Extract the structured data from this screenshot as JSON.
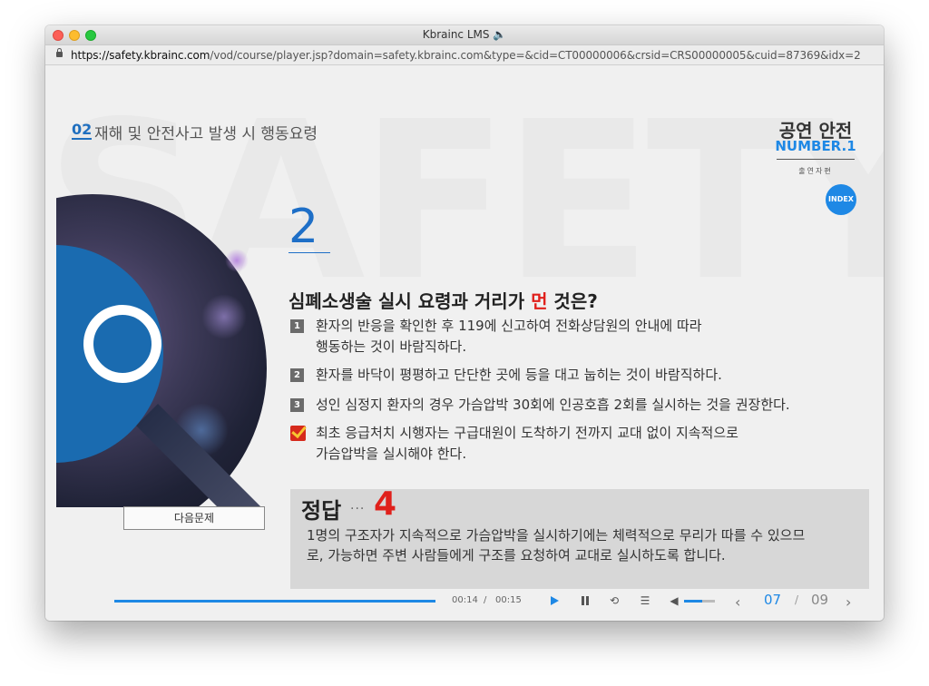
{
  "window": {
    "title": "Kbrainc LMS 🔈"
  },
  "urlbar": {
    "host": "https://safety.kbrainc.com",
    "path": "/vod/course/player.jsp?domain=safety.kbrainc.com&type=&cid=CT00000006&crsid=CRS00000005&cuid=87369&idx=2"
  },
  "header": {
    "section_num": "02",
    "section_title": "재해 및 안전사고 발생 시 행동요령"
  },
  "brand": {
    "title": "공연 안전",
    "number": "NUMBER.1",
    "sub": "출연자편",
    "index_label": "INDEX"
  },
  "question": {
    "number": "2",
    "text_before": "심폐소생술 실시 요령과 거리가 ",
    "text_red": "먼",
    "text_after": " 것은?",
    "options": [
      {
        "num": "1",
        "line1": "환자의 반응을 확인한 후 119에 신고하여 전화상담원의 안내에 따라",
        "line2": "행동하는 것이 바람직하다."
      },
      {
        "num": "2",
        "line1": "환자를 바닥이 평평하고 단단한 곳에 등을 대고 눕히는 것이 바람직하다."
      },
      {
        "num": "3",
        "line1": "성인 심정지 환자의 경우 가슴압박 30회에 인공호흡 2회를 실시하는 것을 권장한다."
      },
      {
        "num": "4",
        "line1": "최초 응급처치 시행자는 구급대원이 도착하기 전까지 교대 없이 지속적으로",
        "line2": "가슴압박을 실시해야 한다.",
        "checked": true
      }
    ]
  },
  "next_button": "다음문제",
  "answer": {
    "label": "정답",
    "dots": "···",
    "value": "4",
    "explanation": "1명의 구조자가 지속적으로 가슴압박을 실시하기에는 체력적으로 무리가 따를 수 있으므로, 가능하면 주변 사람들에게 구조를 요청하여 교대로 실시하도록 합니다."
  },
  "player": {
    "progress": 1.0,
    "current_time": "00:14",
    "separator": "/",
    "total_time": "00:15",
    "volume": 0.6,
    "page_current": "07",
    "page_separator": "/",
    "page_total": "09"
  },
  "colors": {
    "accent": "#1e88e5",
    "red": "#e0201b",
    "q_blue": "#1a6bb0"
  },
  "icons": [
    "play-icon",
    "pause-icon",
    "repeat-icon",
    "menu-icon",
    "volume-icon",
    "chevron-left-icon",
    "chevron-right-icon"
  ]
}
